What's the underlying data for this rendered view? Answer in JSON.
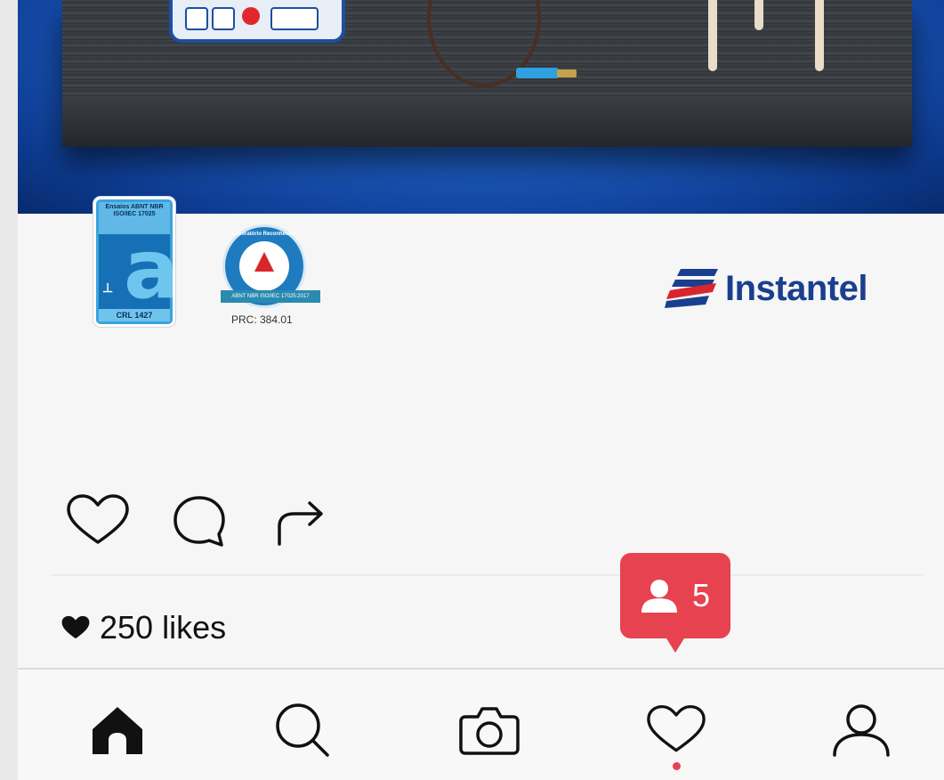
{
  "hero": {
    "description_icon": "product-photo"
  },
  "badges": {
    "accreditation": {
      "top_text": "Ensaios ABNT NBR ISO/IEC 17025",
      "letter": "a",
      "bottom_text": "CRL 1427"
    },
    "seal": {
      "ring_text": "Laboratório Reconhecido",
      "band_text": "ABNT NBR ISO/IEC 17025:2017",
      "caption": "PRC: 384.01"
    },
    "brand": {
      "name": "Instantel"
    }
  },
  "post": {
    "likes_text": "250 likes"
  },
  "notification": {
    "count": "5",
    "icon": "user-icon"
  },
  "colors": {
    "accent": "#e6424f",
    "brand_blue": "#1a3f8f"
  },
  "tabbar": {
    "items": [
      "home-icon",
      "search-icon",
      "camera-icon",
      "heart-icon",
      "profile-icon"
    ],
    "active_dot_tab": "heart-icon"
  }
}
